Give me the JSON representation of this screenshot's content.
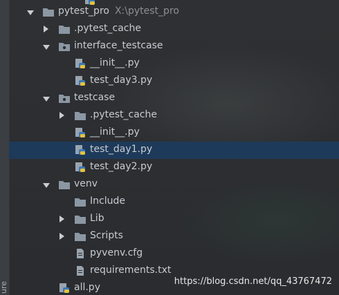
{
  "tree": {
    "top_row_partial": "",
    "root": {
      "name": "pytest_pro",
      "path": "X:\\pytest_pro"
    },
    "items": [
      {
        "label": ".pytest_cache"
      },
      {
        "label": "interface_testcase"
      },
      {
        "label": "__init__.py"
      },
      {
        "label": "test_day3.py"
      },
      {
        "label": "testcase"
      },
      {
        "label": ".pytest_cache"
      },
      {
        "label": "__init__.py"
      },
      {
        "label": "test_day1.py"
      },
      {
        "label": "test_day2.py"
      },
      {
        "label": "venv"
      },
      {
        "label": "Include"
      },
      {
        "label": "Lib"
      },
      {
        "label": "Scripts"
      },
      {
        "label": "pyvenv.cfg"
      },
      {
        "label": "requirements.txt"
      },
      {
        "label": "all.py"
      }
    ]
  },
  "gutter": {
    "label": "ure"
  },
  "watermark": "https://blog.csdn.net/qq_43767472",
  "colors": {
    "folder": "#8b97a3",
    "selection": "#1e3a5a",
    "text": "#c7ccd1"
  },
  "icons": {
    "folder": "folder-icon",
    "module_folder": "module-folder-icon",
    "python_file": "python-file-icon",
    "text_file": "text-file-icon",
    "expanded": "chevron-down-icon",
    "collapsed": "chevron-right-icon"
  }
}
